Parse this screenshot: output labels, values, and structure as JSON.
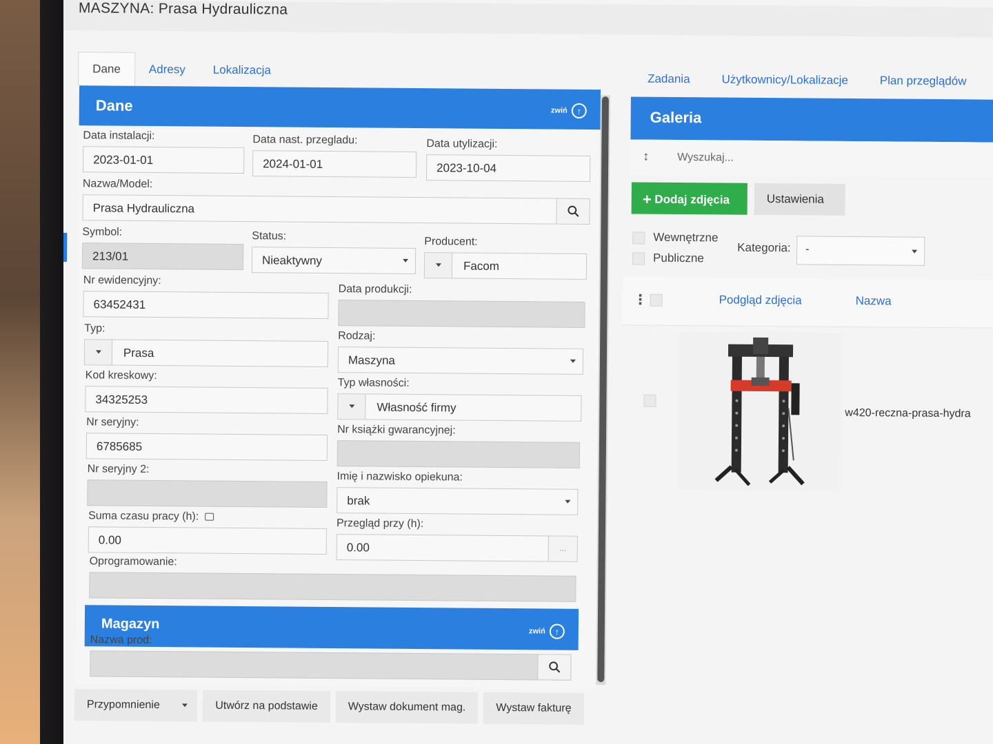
{
  "header": {
    "title": "MASZYNA: Prasa Hydrauliczna"
  },
  "tabs": [
    "Dane",
    "Adresy",
    "Lokalizacja"
  ],
  "right_tabs": [
    "Zadania",
    "Użytkownicy/Lokalizacje",
    "Plan przeglądów"
  ],
  "dane": {
    "title": "Dane",
    "collapse_label": "zwiń",
    "data_instalacji": {
      "label": "Data instalacji:",
      "value": "2023-01-01"
    },
    "data_nast_przegladu": {
      "label": "Data nast. przegladu:",
      "value": "2024-01-01"
    },
    "data_utylizacji": {
      "label": "Data utylizacji:",
      "value": "2023-10-04"
    },
    "nazwa_model": {
      "label": "Nazwa/Model:",
      "value": "Prasa Hydrauliczna"
    },
    "symbol": {
      "label": "Symbol:",
      "value": "213/01"
    },
    "status": {
      "label": "Status:",
      "value": "Nieaktywny"
    },
    "producent": {
      "label": "Producent:",
      "value": "Facom"
    },
    "nr_ewidencyjny": {
      "label": "Nr ewidencyjny:",
      "value": "63452431"
    },
    "data_produkcji": {
      "label": "Data produkcji:",
      "value": ""
    },
    "typ": {
      "label": "Typ:",
      "value": "Prasa"
    },
    "rodzaj": {
      "label": "Rodzaj:",
      "value": "Maszyna"
    },
    "kod_kreskowy": {
      "label": "Kod kreskowy:",
      "value": "34325253"
    },
    "typ_wlasnosci": {
      "label": "Typ własności:",
      "value": "Własność firmy"
    },
    "nr_seryjny": {
      "label": "Nr seryjny:",
      "value": "6785685"
    },
    "nr_ksiazki": {
      "label": "Nr książki gwarancyjnej:",
      "value": ""
    },
    "nr_seryjny_2": {
      "label": "Nr seryjny 2:",
      "value": ""
    },
    "opiekun": {
      "label": "Imię i nazwisko opiekuna:",
      "value": "brak"
    },
    "suma_czasu": {
      "label": "Suma czasu pracy (h):",
      "value": "0.00"
    },
    "przeglad_przy": {
      "label": "Przegląd przy (h):",
      "value": "0.00",
      "spin": "..."
    },
    "oprogramowanie": {
      "label": "Oprogramowanie:",
      "value": ""
    }
  },
  "magazyn": {
    "title": "Magazyn",
    "collapse_label": "zwiń",
    "nazwa_prod": {
      "label": "Nazwa prod:",
      "value": ""
    }
  },
  "bottom_buttons": {
    "przypomnienie": "Przypomnienie",
    "utworz": "Utwórz na podstawie",
    "wystaw_dok": "Wystaw dokument mag.",
    "wystaw_fakt": "Wystaw fakturę"
  },
  "galeria": {
    "title": "Galeria",
    "search_placeholder": "Wyszukaj...",
    "add_button": "Dodaj zdjęcia",
    "settings_button": "Ustawienia",
    "wewnetrzne": "Wewnętrzne",
    "publiczne": "Publiczne",
    "kategoria_label": "Kategoria:",
    "kategoria_value": "-",
    "col_preview": "Podgląd zdjęcia",
    "col_name": "Nazwa",
    "row_filename": "w420-reczna-prasa-hydra"
  },
  "colors": {
    "primary": "#2b80df",
    "success": "#2fad4a",
    "link": "#2d6fd1"
  }
}
